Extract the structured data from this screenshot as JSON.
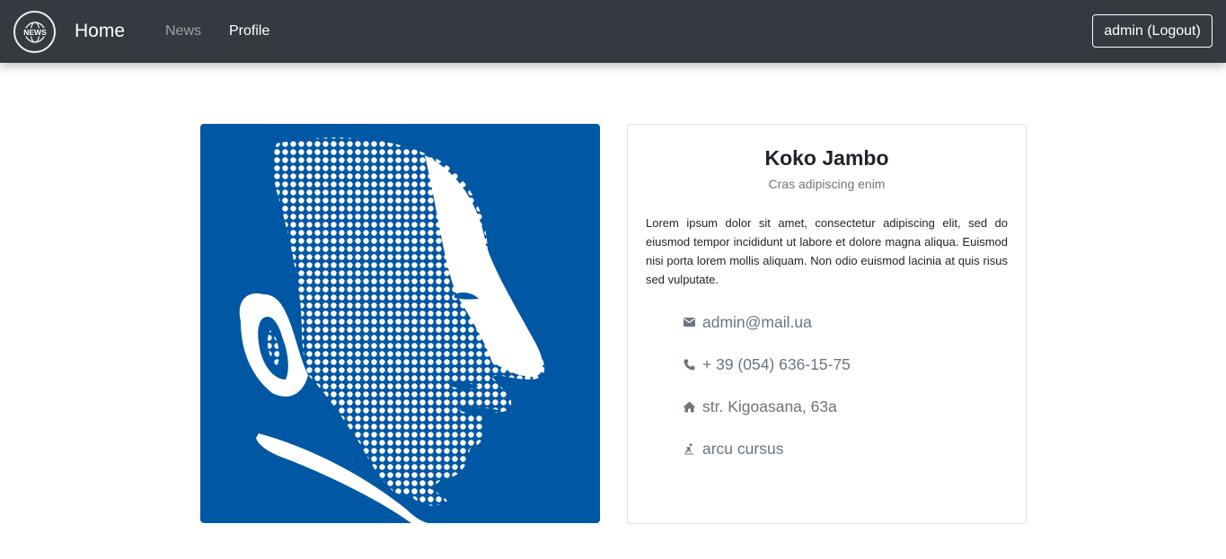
{
  "navbar": {
    "logo_text": "NEWS",
    "brand": "Home",
    "links": [
      {
        "label": "News",
        "active": false
      },
      {
        "label": "Profile",
        "active": true
      }
    ],
    "logout_label": "admin (Logout)",
    "background": "#343a40"
  },
  "profile": {
    "portrait_icon": "halftone-portrait-image",
    "portrait_color": "#0057a3",
    "name": "Koko Jambo",
    "subtitle": "Cras adipiscing enim",
    "description": "Lorem ipsum dolor sit amet, consectetur adipiscing elit, sed do eiusmod tempor incididunt ut labore et dolore magna aliqua. Euismod nisi porta lorem mollis aliquam. Non odio euismod lacinia at quis risus sed vulputate.",
    "contacts": [
      {
        "icon": "envelope-icon",
        "value": "admin@mail.ua"
      },
      {
        "icon": "phone-icon",
        "value": "+ 39 (054) 636-15-75"
      },
      {
        "icon": "home-icon",
        "value": "str. Kigoasana, 63a"
      },
      {
        "icon": "skater-icon",
        "value": "arcu cursus"
      }
    ]
  }
}
